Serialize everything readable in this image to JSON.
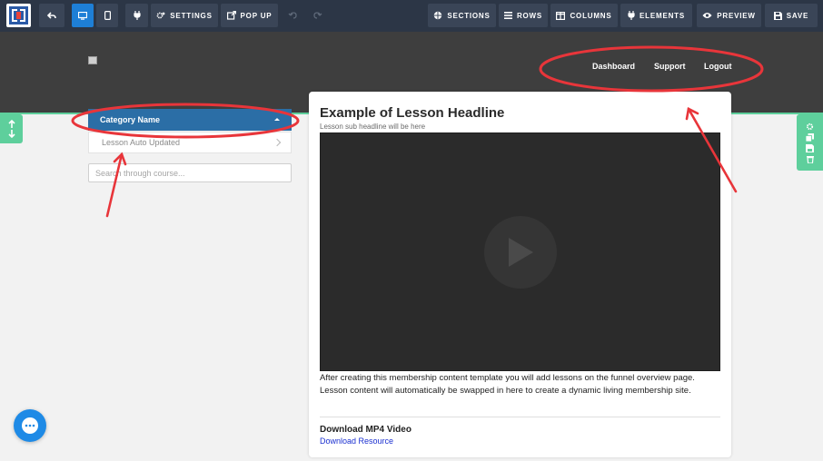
{
  "toolbar": {
    "settings_label": "SETTINGS",
    "popup_label": "POP UP",
    "sections_label": "SECTIONS",
    "rows_label": "ROWS",
    "columns_label": "COLUMNS",
    "elements_label": "ELEMENTS",
    "preview_label": "PREVIEW",
    "save_label": "SAVE"
  },
  "header": {
    "nav": [
      "Dashboard",
      "Support",
      "Logout"
    ]
  },
  "sidebar": {
    "category_name": "Category Name",
    "lessons": [
      "Lesson Auto Updated"
    ],
    "search_placeholder": "Search through course..."
  },
  "lesson": {
    "headline": "Example of Lesson Headline",
    "subheadline": "Lesson sub headline will be here",
    "body": "After creating this membership content template you will add lessons on the funnel overview page. Lesson content will automatically be swapped in here to create a dynamic living membership site.",
    "download_heading": "Download MP4 Video",
    "download_link": "Download Resource"
  },
  "colors": {
    "toolbar_bg": "#2c3646",
    "toolbar_button": "#3a4557",
    "active_blue": "#1e7fd6",
    "header_bg": "#3e3e3e",
    "category_bg": "#2b6ea6",
    "handle_green": "#5ecf9c",
    "annotation_red": "#e8353a",
    "link_blue": "#1a2fd0"
  },
  "icons": {
    "undo": "undo-icon",
    "desktop": "desktop-icon",
    "mobile": "mobile-icon",
    "plug": "plug-icon",
    "settings": "gear-icon",
    "popup": "external-window-icon",
    "redo": "redo-icon",
    "sections": "sections-icon",
    "rows": "rows-icon",
    "columns": "columns-icon",
    "elements": "elements-icon",
    "preview": "eye-icon",
    "save": "save-icon",
    "play": "play-icon",
    "chat": "chat-icon"
  }
}
